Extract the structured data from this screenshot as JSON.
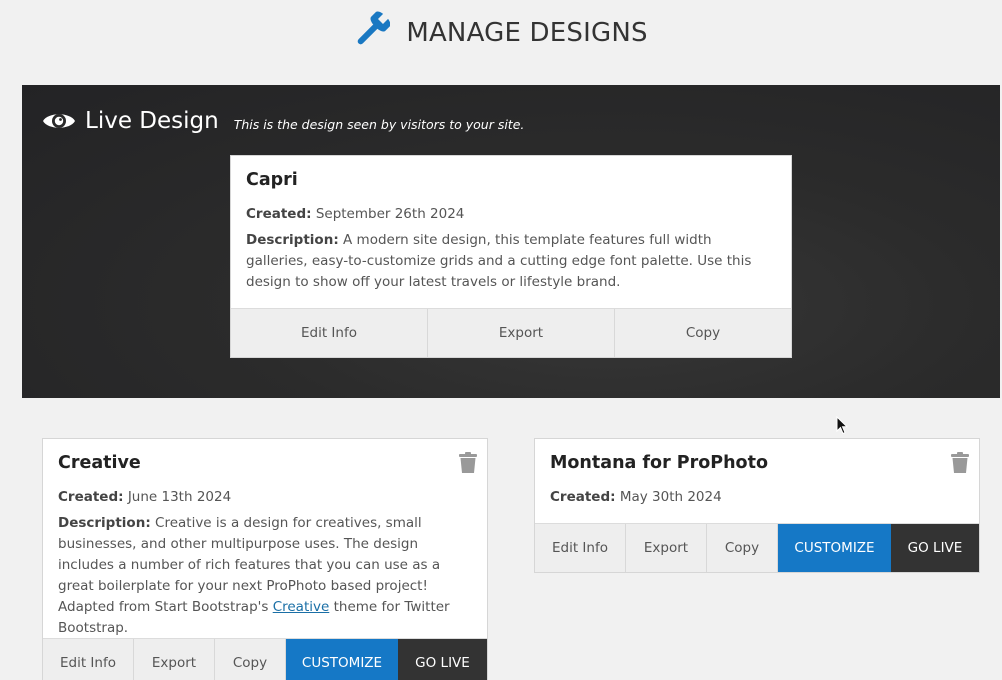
{
  "header": {
    "title": "MANAGE DESIGNS",
    "icon": "wrench-icon",
    "icon_color": "#1a78c2"
  },
  "live": {
    "icon": "eye-icon",
    "title": "Live Design",
    "subtitle": "This is the design seen by visitors to your site.",
    "design": {
      "name": "Capri",
      "created_label": "Created:",
      "created": "September 26th 2024",
      "description_label": "Description:",
      "description": "A modern site design, this template features full width galleries, easy-to-customize grids and a cutting edge font palette. Use this design to show off your latest travels or lifestyle brand.",
      "actions": [
        "Edit Info",
        "Export",
        "Copy"
      ]
    }
  },
  "designs": [
    {
      "name": "Creative",
      "created_label": "Created:",
      "created": "June 13th 2024",
      "description_label": "Description:",
      "description_before": "Creative is a design for creatives, small businesses, and other multipurpose uses. The design includes a number of rich features that you can use as a great boilerplate for your next ProPhoto based project! Adapted from Start Bootstrap's ",
      "description_link": "Creative",
      "description_after": " theme for Twitter Bootstrap.",
      "actions": [
        "Edit Info",
        "Export",
        "Copy",
        "CUSTOMIZE",
        "GO LIVE"
      ]
    },
    {
      "name": "Montana for ProPhoto",
      "created_label": "Created:",
      "created": "May 30th 2024",
      "actions": [
        "Edit Info",
        "Export",
        "Copy",
        "CUSTOMIZE",
        "GO LIVE"
      ]
    }
  ],
  "colors": {
    "accent": "#1578c6",
    "go_live": "#333333",
    "live_bg": "#2b2b2b"
  }
}
